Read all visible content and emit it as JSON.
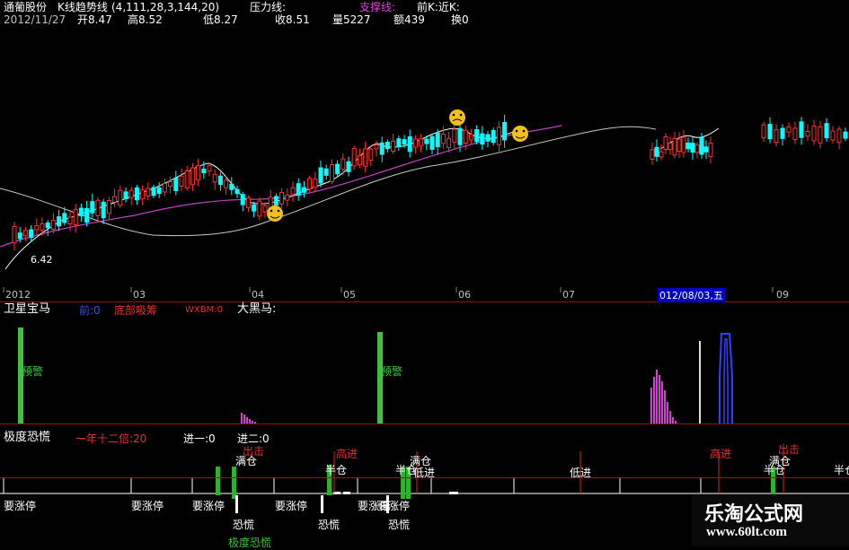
{
  "header": {
    "stock_name": "通葡股份",
    "indicator_name": "K线趋势线",
    "indicator_params": "(4,111,28,3,144,20)",
    "pressure_label": "压力线:",
    "support_label": "支撑线:",
    "front_label": "前K:近K:",
    "date": "2012/11/27",
    "open": "开8.47",
    "high": "高8.52",
    "low": "低8.27",
    "close": "收8.51",
    "volume": "量5227",
    "amount": "额439",
    "turnover": "换0"
  },
  "main_chart": {
    "price_label": "6.42",
    "month_axis": [
      "2012",
      "03",
      "04",
      "05",
      "06",
      "07",
      "012/08/03,五",
      "09"
    ]
  },
  "panel2": {
    "title": "卫星宝马",
    "field1": "前:0",
    "field2": "底部吸筹",
    "field3": "WXBM:0",
    "field4": "大黑马:",
    "marker1": "预警",
    "marker2": "预警"
  },
  "panel3": {
    "title": "极度恐慌",
    "field1": "一年十二倍:20",
    "field2": "进一:0",
    "field3": "进二:0",
    "labels_top": [
      "出击",
      "满仓",
      "高进",
      "满仓",
      "出击",
      "高进",
      "满仓"
    ],
    "labels_mid": [
      "半仓",
      "半仓",
      "低进",
      "半仓",
      "低进",
      "半仓"
    ],
    "labels_bottom": [
      "要涨停",
      "要涨停",
      "要涨停",
      "要涨停",
      "要涨停",
      "要涨停"
    ],
    "labels_fear": [
      "恐慌",
      "恐慌",
      "恐慌",
      "极度恐慌"
    ]
  },
  "watermark": {
    "title": "乐淘公式网",
    "url": "www.60lt.com"
  },
  "colors": {
    "background": "#000000",
    "separator": "#a01010",
    "up": "#ff3030",
    "down": "#00ffff",
    "magenta": "#d040d0",
    "green": "#40c040",
    "yellow": "#ffff40"
  }
}
